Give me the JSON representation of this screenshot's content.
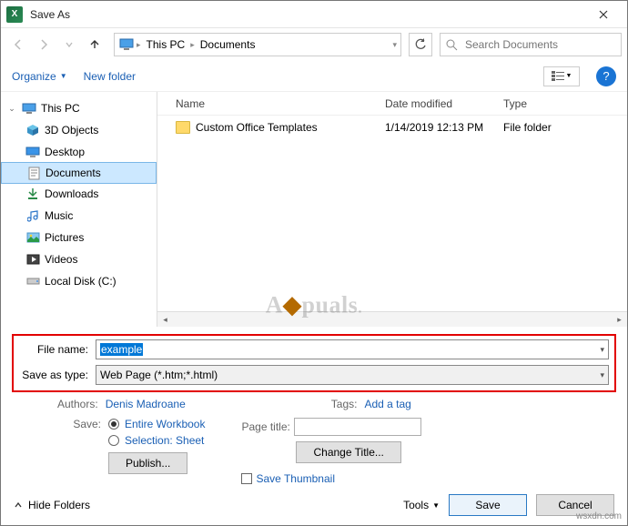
{
  "title": "Save As",
  "breadcrumb": {
    "root": "This PC",
    "folder": "Documents"
  },
  "search": {
    "placeholder": "Search Documents"
  },
  "toolbar": {
    "organize": "Organize",
    "new_folder": "New folder"
  },
  "tree": {
    "root": "This PC",
    "items": [
      {
        "label": "3D Objects"
      },
      {
        "label": "Desktop"
      },
      {
        "label": "Documents"
      },
      {
        "label": "Downloads"
      },
      {
        "label": "Music"
      },
      {
        "label": "Pictures"
      },
      {
        "label": "Videos"
      },
      {
        "label": "Local Disk (C:)"
      }
    ]
  },
  "list": {
    "columns": {
      "name": "Name",
      "date": "Date modified",
      "type": "Type"
    },
    "rows": [
      {
        "name": "Custom Office Templates",
        "date": "1/14/2019 12:13 PM",
        "type": "File folder"
      }
    ]
  },
  "form": {
    "filename_label": "File name:",
    "filename_value": "example",
    "type_label": "Save as type:",
    "type_value": "Web Page (*.htm;*.html)",
    "authors_label": "Authors:",
    "authors_value": "Denis Madroane",
    "tags_label": "Tags:",
    "tags_value": "Add a tag",
    "save_label": "Save:",
    "radio_workbook": "Entire Workbook",
    "radio_selection": "Selection: Sheet",
    "publish": "Publish...",
    "page_title_label": "Page title:",
    "change_title": "Change Title...",
    "save_thumb": "Save Thumbnail"
  },
  "footer": {
    "hide_folders": "Hide Folders",
    "tools": "Tools",
    "save": "Save",
    "cancel": "Cancel"
  },
  "watermark": "A puals",
  "corner": "wsxdn.com"
}
